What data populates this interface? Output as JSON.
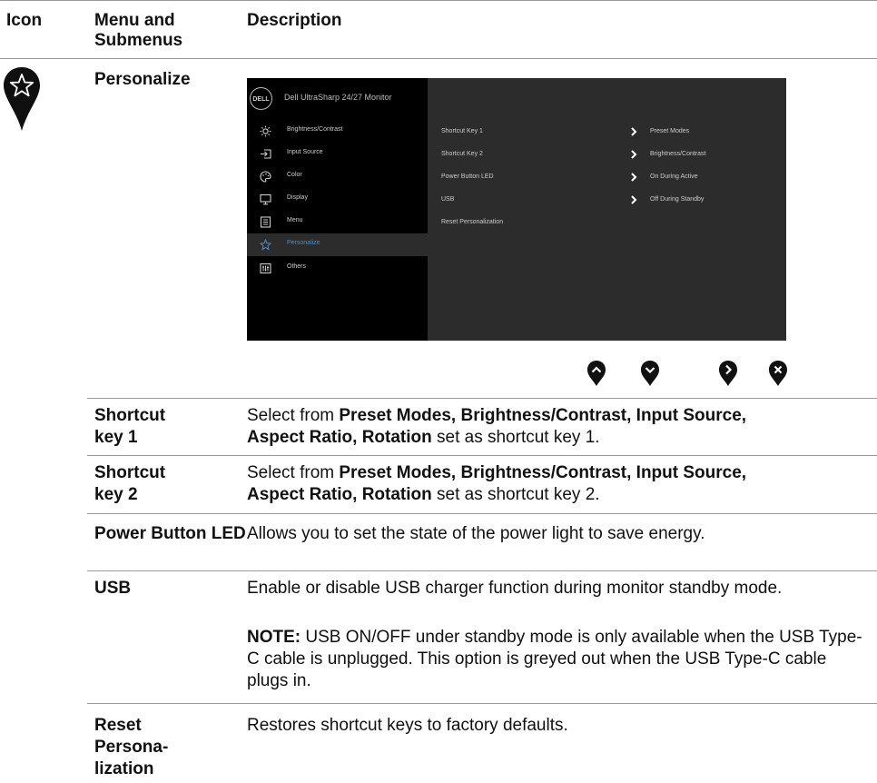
{
  "header": {
    "icon": "Icon",
    "menu": "Menu and Submenus",
    "description": "Description"
  },
  "section": {
    "title": "Personalize",
    "icon": "star-pin-icon"
  },
  "osd": {
    "logo": "DELL",
    "title": "Dell UltraSharp 24/27 Monitor",
    "menu": [
      {
        "label": "Brightness/Contrast",
        "icon": "sun-icon"
      },
      {
        "label": "Input Source",
        "icon": "input-icon"
      },
      {
        "label": "Color",
        "icon": "palette-icon"
      },
      {
        "label": "Display",
        "icon": "display-icon"
      },
      {
        "label": "Menu",
        "icon": "menu-icon"
      },
      {
        "label": "Personalize",
        "icon": "star-icon",
        "selected": true
      },
      {
        "label": "Others",
        "icon": "others-icon"
      }
    ],
    "submenu": [
      {
        "label": "Shortcut Key 1",
        "value": "Preset Modes"
      },
      {
        "label": "Shortcut Key 2",
        "value": "Brightness/Contrast"
      },
      {
        "label": "Power Button LED",
        "value": "On During Active"
      },
      {
        "label": "USB",
        "value": "Off During Standby"
      },
      {
        "label": "Reset Personalization",
        "value": ""
      }
    ],
    "highlight_color": "#3f8fd8"
  },
  "nav_buttons": [
    "up-button-icon",
    "down-button-icon",
    "right-button-icon",
    "exit-button-icon"
  ],
  "rows": [
    {
      "name": "Shortcut key 1",
      "desc_pre": "Select from ",
      "desc_bold": "Preset Modes, Brightness/Contrast, Input Source, Aspect Ratio, Rotation",
      "desc_post": " set as shortcut key 1."
    },
    {
      "name": "Shortcut key 2",
      "desc_pre": "Select from ",
      "desc_bold": "Preset Modes, Brightness/Contrast, Input Source, Aspect Ratio, Rotation",
      "desc_post": " set as shortcut key 2."
    },
    {
      "name": "Power Button LED",
      "desc": "Allows you to set the state of the power light to save energy."
    },
    {
      "name": "USB",
      "desc": "Enable or disable USB charger function during monitor standby mode.",
      "note_label": "NOTE:",
      "note": " USB ON/OFF under standby mode is only available when the USB Type-C cable is unplugged. This option is greyed out when the USB Type-C cable plugs in."
    },
    {
      "name": "Reset Persona-lization",
      "desc": "Restores shortcut keys to factory defaults."
    }
  ]
}
